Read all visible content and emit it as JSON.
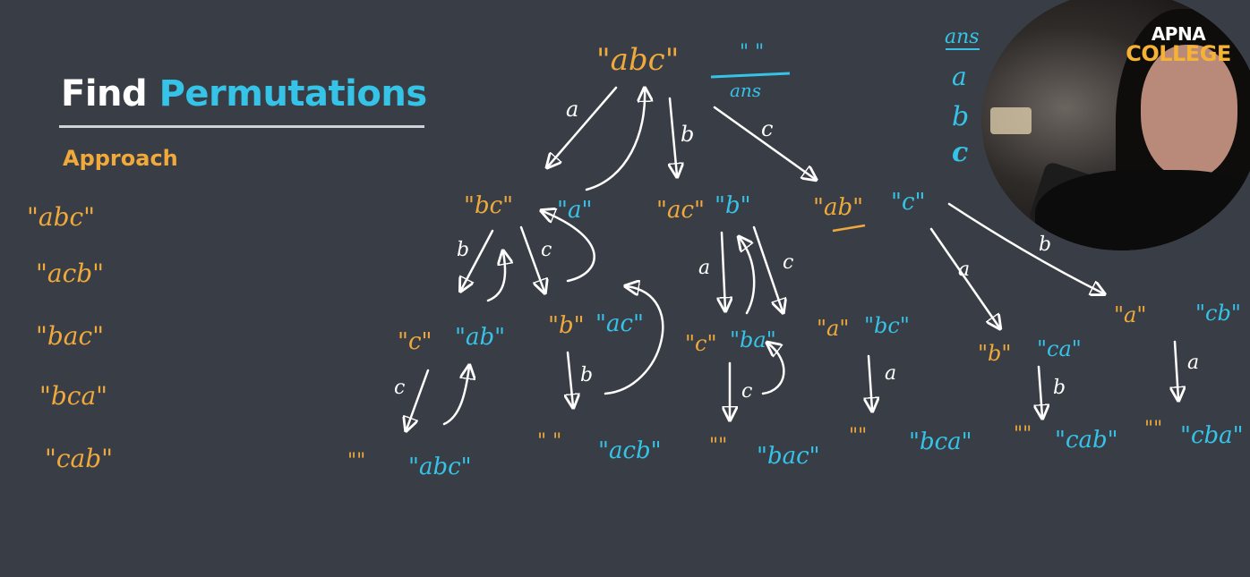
{
  "title": {
    "word1": "Find",
    "word2": "Permutations"
  },
  "subtitle": "Approach",
  "left_list": [
    "\"abc\"",
    "\"acb\"",
    "\"bac\"",
    "\"bca\"",
    "\"cab\""
  ],
  "ans_box": {
    "top": "\" \"",
    "bottom": "ans"
  },
  "right_column": [
    "ans",
    "a",
    "b",
    "c"
  ],
  "logo": {
    "line1": "APNA",
    "line2": "COLLEGE"
  },
  "colors": {
    "board": "#393e46",
    "orange": "#f0a93a",
    "blue": "#35c3e8",
    "white": "#ffffff"
  },
  "tree": {
    "root": "\"abc\"",
    "root_edges": [
      "a",
      "b",
      "c"
    ],
    "level1": [
      {
        "rest": "\"bc\"",
        "ans": "\"a\"",
        "edges": [
          "b",
          "c"
        ]
      },
      {
        "rest": "\"ac\"",
        "ans": "\"b\"",
        "edges": [
          "a",
          "c"
        ]
      },
      {
        "rest": "\"ab\"",
        "ans": "\"c\"",
        "edges": [
          "a",
          "b"
        ]
      }
    ],
    "level2": [
      {
        "rest": "\"c\"",
        "ans": "\"ab\"",
        "edge": "c"
      },
      {
        "rest": "\"b\"",
        "ans": "\"ac\"",
        "edge": "b"
      },
      {
        "rest": "\"c\"",
        "ans": "\"ba\"",
        "edge": "c"
      },
      {
        "rest": "\"a\"",
        "ans": "\"bc\"",
        "edge": "a"
      },
      {
        "rest": "\"b\"",
        "ans": "\"ca\"",
        "edge": "b"
      },
      {
        "rest": "\"a\"",
        "ans": "\"cb\"",
        "edge": "a"
      }
    ],
    "leaves": [
      {
        "rest": "\"\"",
        "ans": "\"abc\""
      },
      {
        "rest": "\" \"",
        "ans": "\"acb\""
      },
      {
        "rest": "\"\"",
        "ans": "\"bac\""
      },
      {
        "rest": "\"\"",
        "ans": "\"bca\""
      },
      {
        "rest": "\"\"",
        "ans": "\"cab\""
      },
      {
        "rest": "\"\"",
        "ans": "\"cba\""
      }
    ]
  }
}
